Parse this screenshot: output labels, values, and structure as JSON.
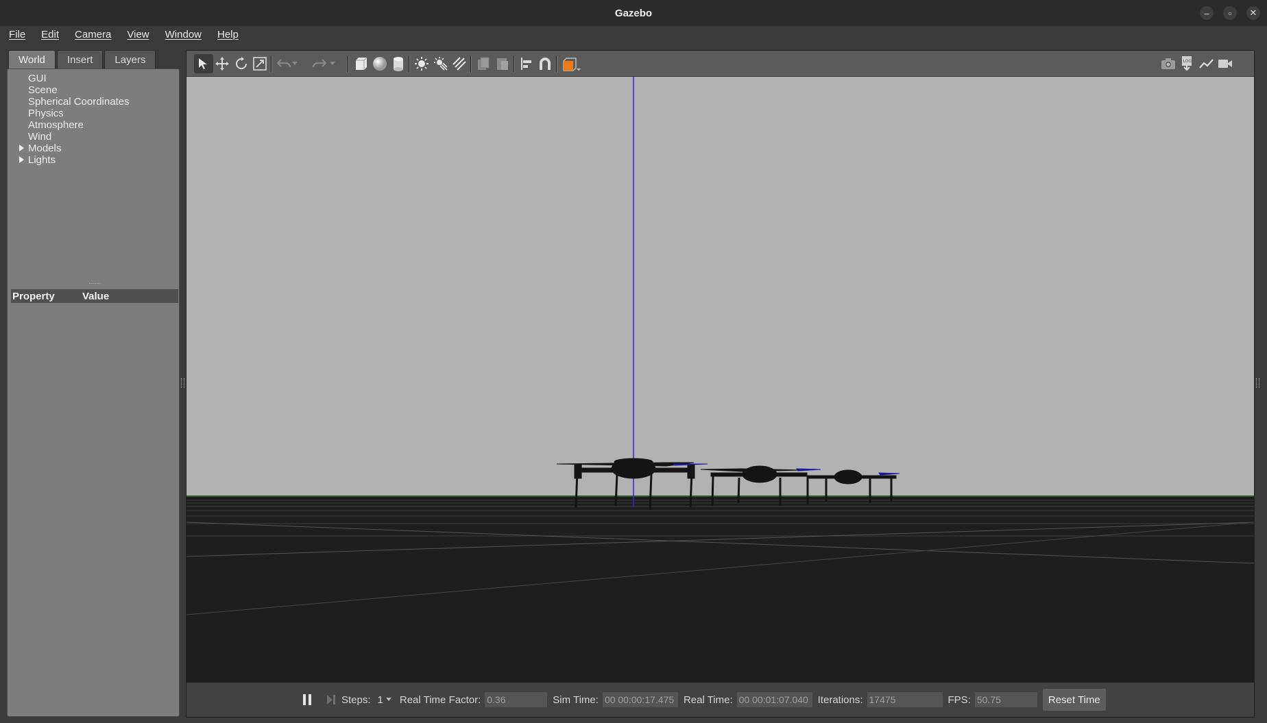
{
  "window": {
    "title": "Gazebo"
  },
  "menu": [
    "File",
    "Edit",
    "Camera",
    "View",
    "Window",
    "Help"
  ],
  "left_tabs": [
    "World",
    "Insert",
    "Layers"
  ],
  "tree_items": [
    {
      "label": "GUI",
      "expandable": false
    },
    {
      "label": "Scene",
      "expandable": false
    },
    {
      "label": "Spherical Coordinates",
      "expandable": false
    },
    {
      "label": "Physics",
      "expandable": false
    },
    {
      "label": "Atmosphere",
      "expandable": false
    },
    {
      "label": "Wind",
      "expandable": false
    },
    {
      "label": "Models",
      "expandable": true
    },
    {
      "label": "Lights",
      "expandable": true
    }
  ],
  "properties": {
    "col_property": "Property",
    "col_value": "Value"
  },
  "toolbar_icons": [
    "select-arrow-icon",
    "translate-icon",
    "rotate-icon",
    "scale-icon",
    "undo-icon",
    "redo-icon",
    "box-icon",
    "sphere-icon",
    "cylinder-icon",
    "point-light-icon",
    "spot-light-icon",
    "directional-light-icon",
    "copy-icon",
    "paste-icon",
    "align-icon",
    "snap-icon",
    "view-angle-icon",
    "screenshot-icon",
    "log-icon",
    "plot-icon",
    "video-icon"
  ],
  "bottom": {
    "steps_label": "Steps:",
    "steps_value": "1",
    "rtf_label": "Real Time Factor:",
    "rtf_value": "0.36",
    "sim_time_label": "Sim Time:",
    "sim_time_value": "00 00:00:17.475",
    "real_time_label": "Real Time:",
    "real_time_value": "00 00:01:07.040",
    "iterations_label": "Iterations:",
    "iterations_value": "17475",
    "fps_label": "FPS:",
    "fps_value": "50.75",
    "reset_label": "Reset Time"
  },
  "colors": {
    "sky": "#b2b2b2",
    "ground": "#1e1e1e",
    "z_axis": "#2b2bd6",
    "accent_orange": "#f07a1a"
  }
}
